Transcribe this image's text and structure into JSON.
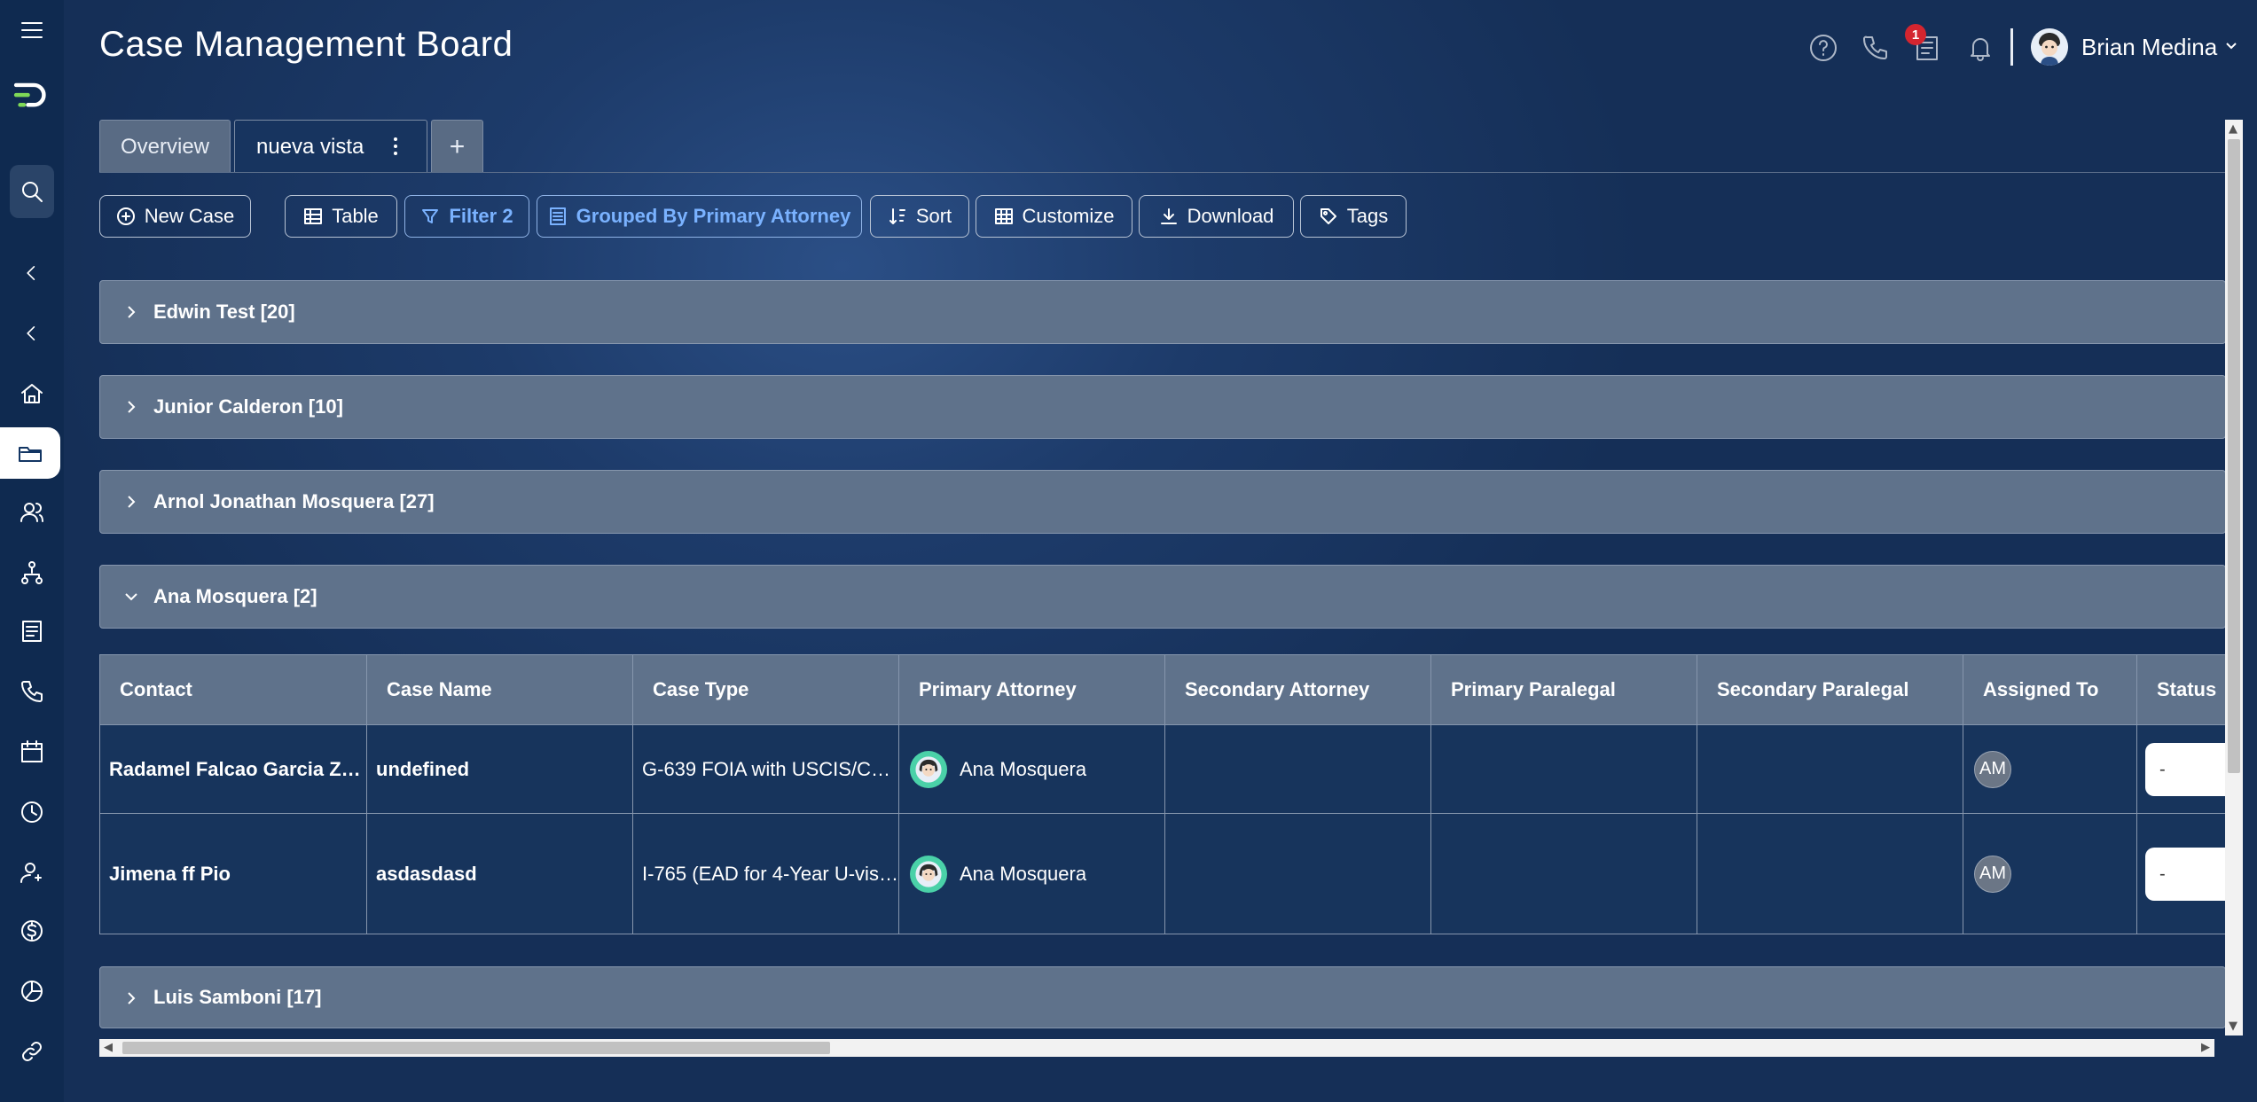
{
  "header": {
    "title": "Case Management Board",
    "notification_count": "1",
    "user_name": "Brian Medina"
  },
  "sidebar": {
    "icons": [
      "menu-icon",
      "logo-icon",
      "search-icon",
      "collapse-icon",
      "back-icon",
      "home-icon",
      "cases-folder-icon",
      "contacts-icon",
      "workflow-icon",
      "forms-icon",
      "phone-icon",
      "calendar-icon",
      "time-icon",
      "user-settings-icon",
      "billing-icon",
      "reports-icon",
      "link-icon"
    ],
    "active": "cases-folder-icon"
  },
  "tabs": {
    "overview": "Overview",
    "current": "nueva vista",
    "add": "+"
  },
  "toolbar": {
    "new_case": "New Case",
    "table": "Table",
    "filter": "Filter 2",
    "grouped": "Grouped By Primary Attorney",
    "sort": "Sort",
    "customize": "Customize",
    "download": "Download",
    "tags": "Tags"
  },
  "groups": [
    {
      "label": "Edwin Test [20]",
      "expanded": false
    },
    {
      "label": "Junior Calderon [10]",
      "expanded": false
    },
    {
      "label": "Arnol Jonathan Mosquera [27]",
      "expanded": false
    },
    {
      "label": "Ana Mosquera [2]",
      "expanded": true
    },
    {
      "label": "Luis Samboni [17]",
      "expanded": false
    }
  ],
  "table": {
    "columns": [
      "Contact",
      "Case Name",
      "Case Type",
      "Primary Attorney",
      "Secondary Attorney",
      "Primary Paralegal",
      "Secondary Paralegal",
      "Assigned To",
      "Status"
    ],
    "rows": [
      {
        "contact": "Radamel Falcao Garcia Zar...",
        "case_name": "undefined",
        "case_type": "G-639 FOIA with USCIS/CBP...",
        "primary_attorney": "Ana Mosquera",
        "secondary_attorney": "",
        "primary_paralegal": "",
        "secondary_paralegal": "",
        "assigned_to": "AM",
        "status": "-"
      },
      {
        "contact": "Jimena ff Pio",
        "case_name": "asdasdasd",
        "case_type": "I-765 (EAD for 4-Year U-visa...",
        "primary_attorney": "Ana Mosquera",
        "secondary_attorney": "",
        "primary_paralegal": "",
        "secondary_paralegal": "",
        "assigned_to": "AM",
        "status": "-"
      }
    ]
  },
  "colors": {
    "sidebar_bg": "#0f2a50",
    "group_bg": "#5f728b",
    "row_bg": "#17345c",
    "accent": "#7ab2ff",
    "badge": "#d4252f"
  }
}
